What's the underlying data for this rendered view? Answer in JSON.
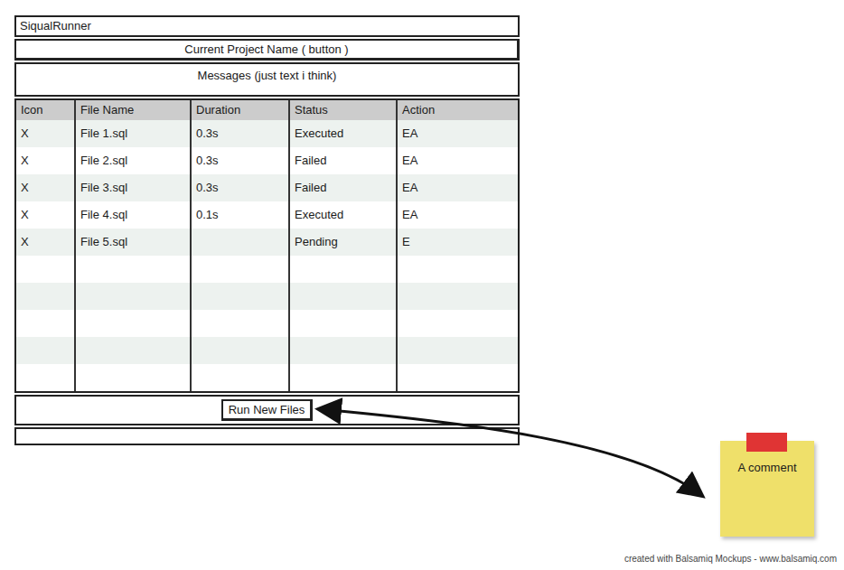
{
  "window": {
    "title": "SiqualRunner"
  },
  "project_button": "Current Project Name ( button )",
  "messages": "Messages (just text i think)",
  "table": {
    "columns": [
      "Icon",
      "File Name",
      "Duration",
      "Status",
      "Action"
    ],
    "rows": [
      {
        "icon": "X",
        "file": "File 1.sql",
        "duration": "0.3s",
        "status": "Executed",
        "action": "EA"
      },
      {
        "icon": "X",
        "file": "File 2.sql",
        "duration": "0.3s",
        "status": "Failed",
        "action": "EA"
      },
      {
        "icon": "X",
        "file": "File 3.sql",
        "duration": "0.3s",
        "status": "Failed",
        "action": "EA"
      },
      {
        "icon": "X",
        "file": "File 4.sql",
        "duration": "0.1s",
        "status": "Executed",
        "action": "EA"
      },
      {
        "icon": "X",
        "file": "File 5.sql",
        "duration": "",
        "status": "Pending",
        "action": "E"
      }
    ]
  },
  "run_button": "Run New Files",
  "note": "A comment",
  "credit": "created with Balsamiq Mockups - www.balsamiq.com"
}
